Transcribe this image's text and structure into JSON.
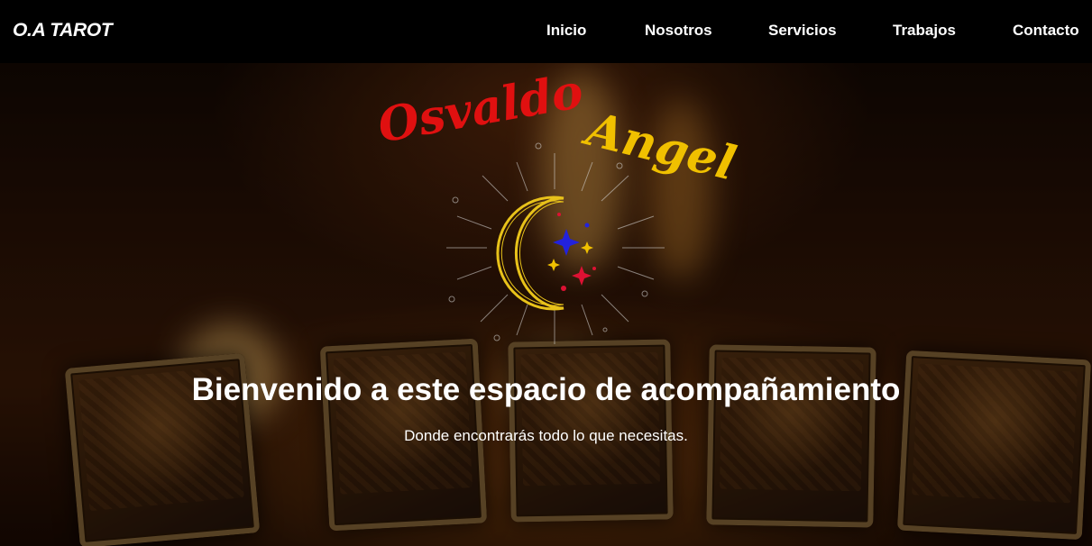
{
  "navbar": {
    "brand": "O.A TAROT",
    "links": [
      "Inicio",
      "Nosotros",
      "Servicios",
      "Trabajos",
      "Contacto"
    ]
  },
  "hero": {
    "logo_name_first": "Osvaldo",
    "logo_name_last": "Angel",
    "heading": "Bienvenido a este espacio de acompañamiento",
    "subheading": "Donde encontrarás todo lo que necesitas."
  },
  "colors": {
    "navbar_bg": "#000000",
    "logo_red": "#e01010",
    "logo_yellow": "#f0c000",
    "moon_gold": "#e8c21a",
    "text": "#ffffff"
  },
  "icons": [
    "moon-emblem-icon",
    "star-icon"
  ]
}
